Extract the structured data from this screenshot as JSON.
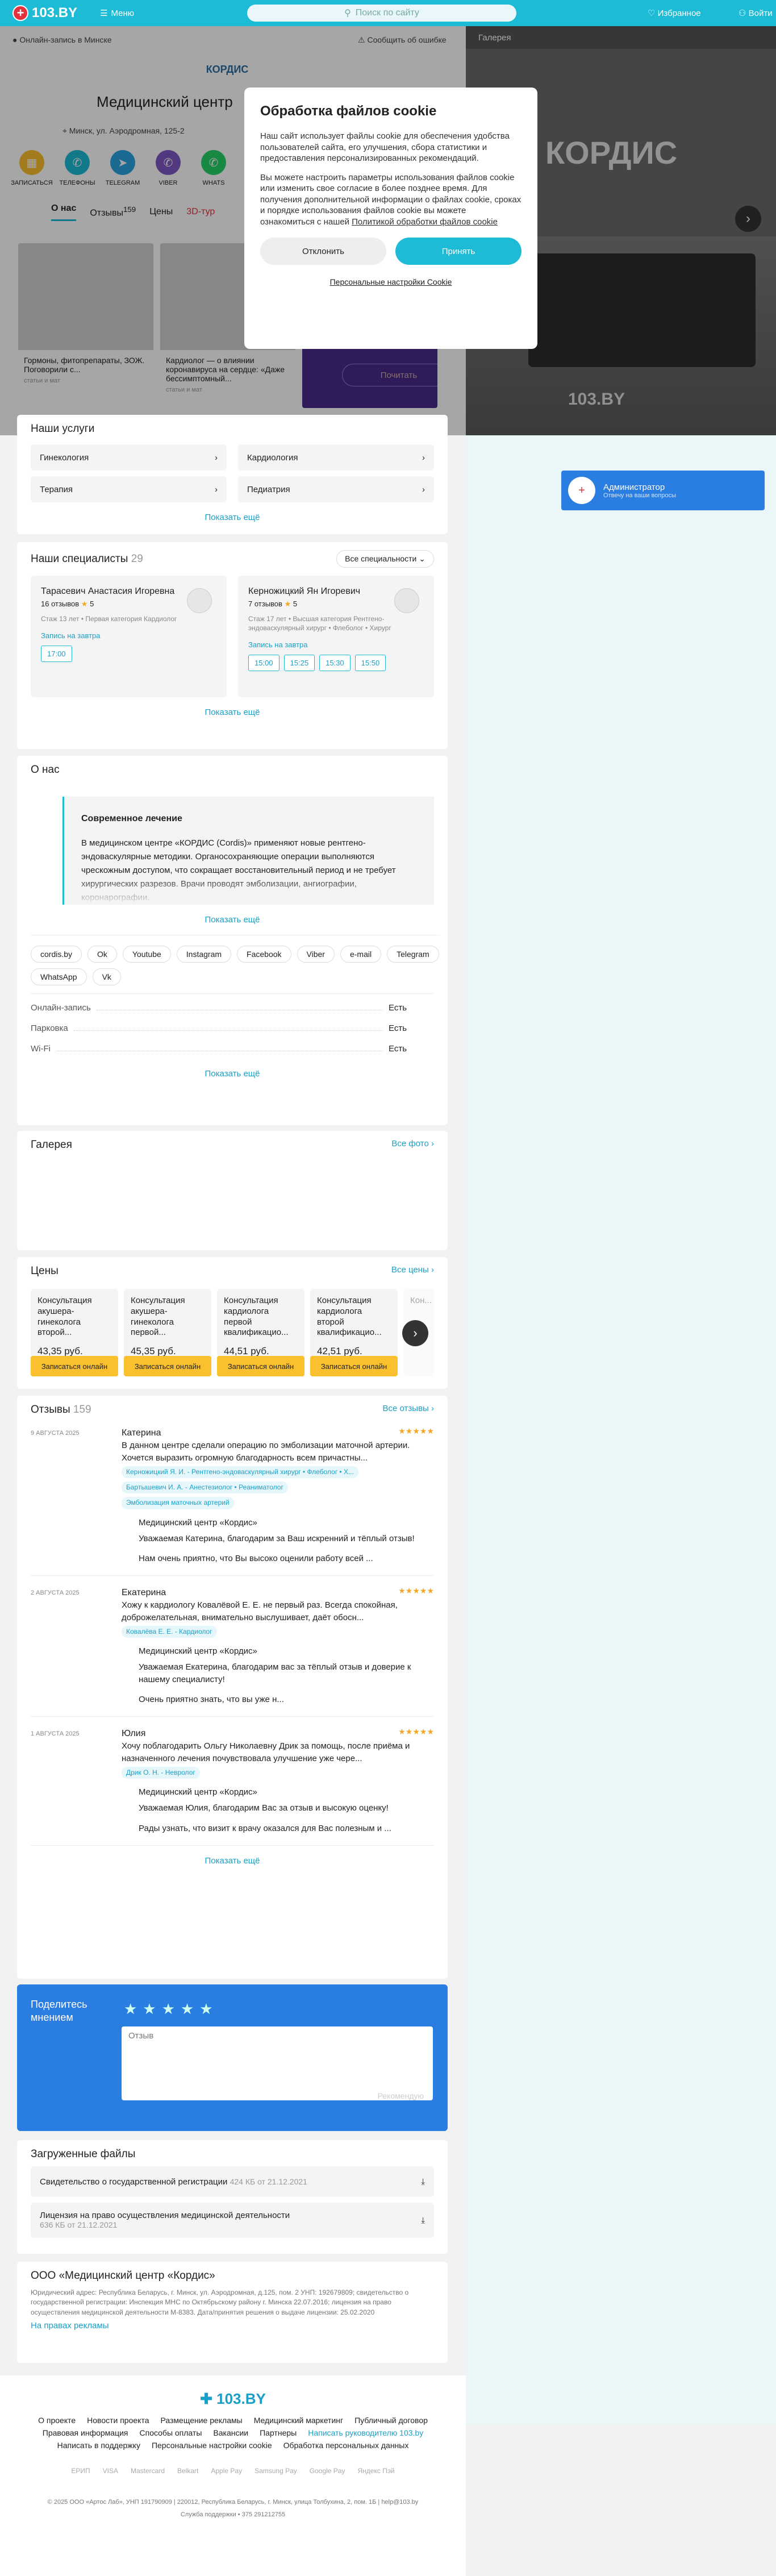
{
  "header": {
    "logo": "103.BY",
    "menu": "Меню",
    "search_placeholder": "Поиск по сайту",
    "favorites": "Избранное",
    "login": "Войти"
  },
  "hero": {
    "online": "Онлайн-запись в Минске",
    "report": "Сообщить об ошибке",
    "clinic_logo": "КОРДИС",
    "title": "Медицинский центр",
    "address": "Минск, ул. Аэродромная, 125-2",
    "actions": [
      {
        "label": "ЗАПИСАТЬСЯ",
        "icon": "calendar-icon",
        "color": "#fbc02d"
      },
      {
        "label": "ТЕЛЕФОНЫ",
        "icon": "phone-icon",
        "color": "#1dbbd6"
      },
      {
        "label": "TELEGRAM",
        "icon": "telegram-icon",
        "color": "#2aa3e0"
      },
      {
        "label": "VIBER",
        "icon": "viber-icon",
        "color": "#7e57c2"
      },
      {
        "label": "WHATS",
        "icon": "whatsapp-icon",
        "color": "#25d366"
      }
    ],
    "tabs": [
      "О нас",
      "Отзывы",
      "Цены",
      "3D-тур"
    ],
    "reviews_count": "159",
    "stories": [
      {
        "title": "Гормоны, фитопрепараты, ЗОЖ. Поговорили с...",
        "meta": "статьи и мат"
      },
      {
        "title": "Кардиолог — о влиянии коронавируса на сердце: «Даже бессимптомный...",
        "meta": "статьи и мат"
      },
      {
        "title": "",
        "meta": ""
      }
    ],
    "story_button": "Почитать"
  },
  "gallery": {
    "title": "Галерея",
    "brand": "КОРДИС",
    "watermark": "103.BY"
  },
  "cookie": {
    "title": "Обработка файлов cookie",
    "p1": "Наш сайт использует файлы cookie для обеспечения удобства пользователей сайта, его улучшения, сбора статистики и предоставления персонализированных рекомендаций.",
    "p2": "Вы можете настроить параметры использования файлов cookie или изменить свое согласие в более позднее время. Для получения дополнительной информации о файлах cookie, сроках и порядке использования файлов cookie вы можете ознакомиться с нашей",
    "policy": "Политикой обработки файлов cookie",
    "reject": "Отклонить",
    "accept": "Принять",
    "settings": "Персональные настройки Cookie"
  },
  "services": {
    "title": "Наши услуги",
    "items": [
      "Гинекология",
      "Кардиология",
      "Терапия",
      "Педиатрия"
    ],
    "more": "Показать ещё"
  },
  "specialists": {
    "title": "Наши специалисты",
    "count": "29",
    "filter": "Все специальности",
    "items": [
      {
        "name": "Тарасевич Анастасия Игоревна",
        "reviews": "16 отзывов",
        "rating": "5",
        "details": "Стаж 13 лет • Первая категория Кардиолог",
        "when": "Запись на завтра",
        "slots": [
          "17:00"
        ]
      },
      {
        "name": "Керножицкий Ян Игоревич",
        "reviews": "7 отзывов",
        "rating": "5",
        "details": "Стаж 17 лет • Высшая категория Рентгено-эндоваскулярный хирург • Флеболог • Хирург",
        "when": "Запись на завтра",
        "slots": [
          "15:00",
          "15:25",
          "15:30",
          "15:50"
        ]
      }
    ],
    "more": "Показать ещё"
  },
  "about": {
    "title": "О нас",
    "box_title": "Современное лечение",
    "box_text": "В медицинском центре «КОРДИС (Cordis)» применяют новые рентгено-эндоваскулярные методики. Органосохраняющие операции выполняются чрескожным доступом, что сокращает восстановительный период и не требует хирургических разрезов. Врачи проводят эмболизации, ангиографии, коронарографии.",
    "more": "Показать ещё"
  },
  "links": [
    "cordis.by",
    "Ok",
    "Youtube",
    "Instagram",
    "Facebook",
    "Viber",
    "e-mail",
    "Telegram",
    "WhatsApp",
    "Vk"
  ],
  "facts": {
    "items": [
      {
        "label": "Онлайн-запись",
        "value": "Есть"
      },
      {
        "label": "Парковка",
        "value": "Есть"
      },
      {
        "label": "Wi-Fi",
        "value": "Есть"
      }
    ],
    "more": "Показать ещё"
  },
  "gallery_block": {
    "title": "Галерея",
    "all": "Все фото"
  },
  "prices": {
    "title": "Цены",
    "all": "Все цены",
    "items": [
      {
        "name": "Консультация акушера-гинеколога второй...",
        "price": "43,35 руб.",
        "btn": "Записаться онлайн"
      },
      {
        "name": "Консультация акушера-гинеколога первой...",
        "price": "45,35 руб.",
        "btn": "Записаться онлайн"
      },
      {
        "name": "Консультация кардиолога первой квалификацио...",
        "price": "44,51 руб.",
        "btn": "Записаться онлайн"
      },
      {
        "name": "Консультация кардиолога второй квалификацио...",
        "price": "42,51 руб.",
        "btn": "Записаться онлайн"
      },
      {
        "name": "Кон...",
        "price": "",
        "btn": ""
      }
    ]
  },
  "reviews": {
    "title": "Отзывы",
    "count": "159",
    "all": "Все отзывы",
    "items": [
      {
        "date": "9 АВГУСТА 2025",
        "name": "Катерина",
        "text": "В данном центре сделали операцию по эмболизации маточной артерии. Хочется выразить огромную благодарность всем причастны...",
        "tags": [
          "Керножицкий Я. И. - Рентгено-эндоваскулярный хирург • Флеболог • Х...",
          "Бартышевич И. А. - Анестезиолог • Реаниматолог",
          "Эмболизация маточных артерий"
        ],
        "reply_head": "Медицинский центр «Кордис»",
        "reply": "Уважаемая Катерина, благодарим за Ваш искренний и тёплый отзыв!",
        "reply2": "Нам очень приятно, что Вы высоко оценили работу всей ..."
      },
      {
        "date": "2 АВГУСТА 2025",
        "name": "Екатерина",
        "text": "Хожу к кардиологу Ковалёвой Е. Е. не первый раз. Всегда спокойная, доброжелательная, внимательно выслушивает, даёт обосн...",
        "tags": [
          "Ковалёва Е. Е. - Кардиолог"
        ],
        "reply_head": "Медицинский центр «Кордис»",
        "reply": "Уважаемая Екатерина, благодарим вас за тёплый отзыв и доверие к нашему специалисту!",
        "reply2": "Очень приятно знать, что вы уже н..."
      },
      {
        "date": "1 АВГУСТА 2025",
        "name": "Юлия",
        "text": "Хочу поблагодарить Ольгу Николаевну Дрик за помощь, после приёма и назначенного лечения почувствовала улучшение уже чере...",
        "tags": [
          "Дрик О. Н. - Невролог"
        ],
        "reply_head": "Медицинский центр «Кордис»",
        "reply": "Уважаемая Юлия, благодарим Вас за отзыв и высокую оценку!",
        "reply2": "Рады узнать, что визит к врачу оказался для Вас полезным и ..."
      }
    ],
    "more": "Показать ещё"
  },
  "opinion": {
    "label": "Поделитесь мнением",
    "placeholder": "Отзыв",
    "send": "Рекомендую"
  },
  "files": {
    "title": "Загруженные файлы",
    "items": [
      {
        "name": "Свидетельство о государственной регистрации",
        "size": "424 КБ от 21.12.2021"
      },
      {
        "name": "Лицензия на право осуществления медицинской деятельности",
        "size": "636 КБ от 21.12.2021"
      }
    ]
  },
  "company": {
    "title": "ООО «Медицинский центр «Кордис»",
    "legal": "Юридический адрес: Республика Беларусь, г. Минск, ул. Аэродромная, д.125, пом. 2 УНП: 192679809; свидетельство о государственной регистрации: Инспекция МНС по Октябрьскому району г. Минска 22.07.2016; лицензия на право осуществления медицинской деятельности М-8383. Дата/принятия решения о выдаче лицензии: 25.02.2020",
    "ad": "На правах рекламы"
  },
  "sidebar": {
    "admin_title": "Администратор",
    "admin_sub": "Отвечу на ваши вопросы"
  },
  "footer": {
    "logo": "103.BY",
    "links": [
      "О проекте",
      "Новости проекта",
      "Размещение рекламы",
      "Медицинский маркетинг",
      "Публичный договор",
      "Правовая информация",
      "Способы оплаты",
      "Вакансии",
      "Партнеры",
      "Написать руководителю 103.by",
      "Написать в поддержку",
      "Персональные настройки cookie",
      "Обработка персональных данных"
    ],
    "pays": [
      "ЕРИП",
      "VISA",
      "Mastercard",
      "Belkart",
      "Apple Pay",
      "Samsung Pay",
      "Google Pay",
      "Яндекс Пэй"
    ],
    "copyright": "© 2025 ООО «Артос Лаб», УНП 191790909 | 220012, Республика Беларусь, г. Минск, улица Толбухина, 2, пом. 1Б | help@103.by",
    "support": "Служба поддержки • 375 291212755"
  }
}
